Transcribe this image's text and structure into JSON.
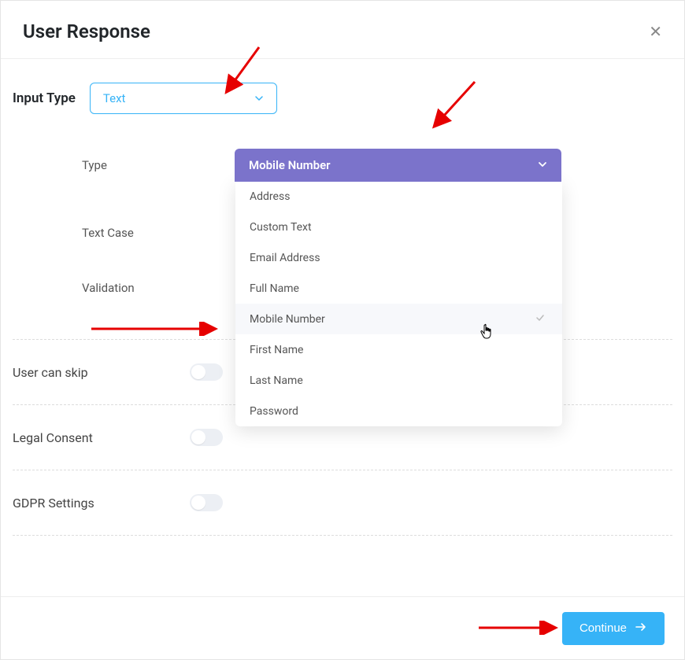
{
  "header": {
    "title": "User Response"
  },
  "inputType": {
    "label": "Input Type",
    "value": "Text"
  },
  "fields": {
    "type": {
      "label": "Type",
      "value": "Mobile Number"
    },
    "textCase": {
      "label": "Text Case"
    },
    "validation": {
      "label": "Validation"
    }
  },
  "dropdown": [
    {
      "label": "Address",
      "selected": false
    },
    {
      "label": "Custom Text",
      "selected": false
    },
    {
      "label": "Email Address",
      "selected": false
    },
    {
      "label": "Full Name",
      "selected": false
    },
    {
      "label": "Mobile Number",
      "selected": true
    },
    {
      "label": "First Name",
      "selected": false
    },
    {
      "label": "Last Name",
      "selected": false
    },
    {
      "label": "Password",
      "selected": false
    }
  ],
  "toggles": {
    "skip": "User can skip",
    "legal": "Legal Consent",
    "gdpr": "GDPR Settings"
  },
  "footer": {
    "continue": "Continue"
  }
}
